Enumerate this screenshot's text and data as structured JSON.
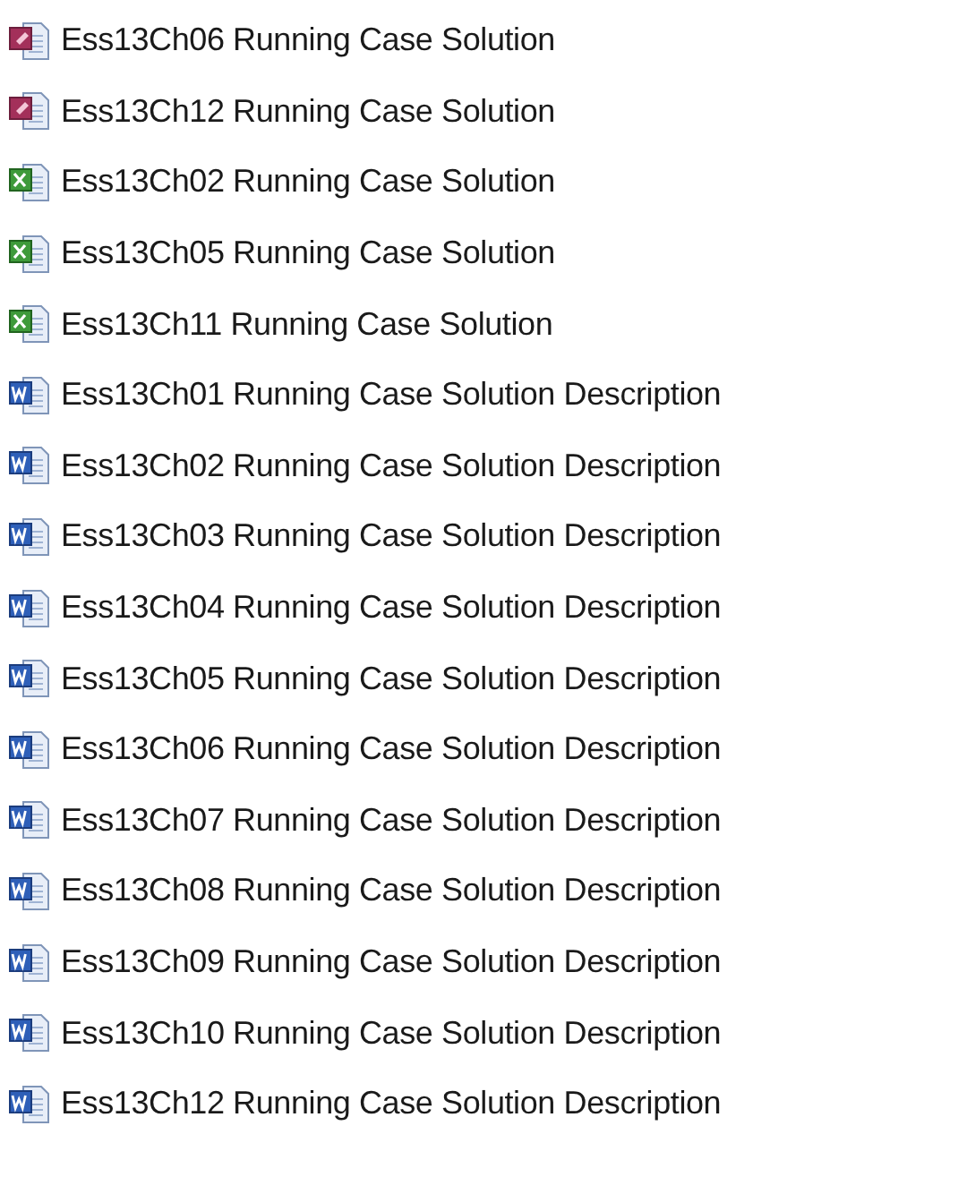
{
  "files": [
    {
      "kind": "access",
      "name": "Ess13Ch06 Running Case Solution"
    },
    {
      "kind": "access",
      "name": "Ess13Ch12 Running Case Solution"
    },
    {
      "kind": "excel",
      "name": "Ess13Ch02 Running Case Solution"
    },
    {
      "kind": "excel",
      "name": "Ess13Ch05 Running Case Solution"
    },
    {
      "kind": "excel",
      "name": "Ess13Ch11 Running Case Solution"
    },
    {
      "kind": "word",
      "name": "Ess13Ch01 Running Case Solution Description"
    },
    {
      "kind": "word",
      "name": "Ess13Ch02 Running Case Solution Description"
    },
    {
      "kind": "word",
      "name": "Ess13Ch03 Running Case Solution Description"
    },
    {
      "kind": "word",
      "name": "Ess13Ch04 Running Case Solution Description"
    },
    {
      "kind": "word",
      "name": "Ess13Ch05 Running Case Solution Description"
    },
    {
      "kind": "word",
      "name": "Ess13Ch06 Running Case Solution Description"
    },
    {
      "kind": "word",
      "name": "Ess13Ch07 Running Case Solution Description"
    },
    {
      "kind": "word",
      "name": "Ess13Ch08 Running Case Solution Description"
    },
    {
      "kind": "word",
      "name": "Ess13Ch09 Running Case Solution Description"
    },
    {
      "kind": "word",
      "name": "Ess13Ch10 Running Case Solution Description"
    },
    {
      "kind": "word",
      "name": "Ess13Ch12 Running Case Solution Description"
    }
  ]
}
